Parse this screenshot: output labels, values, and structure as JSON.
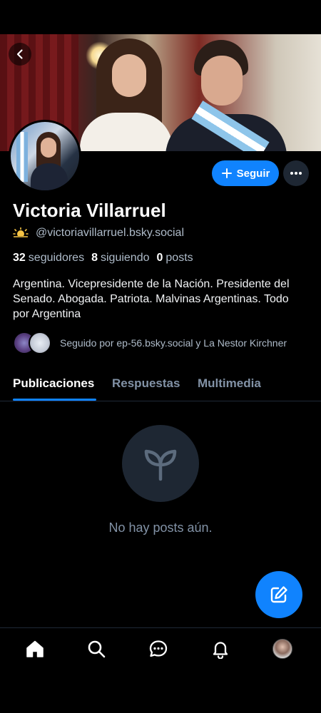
{
  "profile": {
    "display_name": "Victoria Villarruel",
    "handle": "@victoriavillarruel.bsky.social",
    "followers_count": "32",
    "followers_label": "seguidores",
    "following_count": "8",
    "following_label": "siguiendo",
    "posts_count": "0",
    "posts_label": "posts",
    "bio": "Argentina. Vicepresidente de la Nación. Presidente del Senado. Abogada. Patriota. Malvinas Argentinas. Todo por Argentina",
    "followed_by": "Seguido por ep-56.bsky.social y La Nestor Kirchner",
    "handle_emoji": "sun-behind-cloud-icon"
  },
  "actions": {
    "follow_label": "Seguir"
  },
  "tabs": [
    {
      "label": "Publicaciones",
      "active": true
    },
    {
      "label": "Respuestas",
      "active": false
    },
    {
      "label": "Multimedia",
      "active": false
    }
  ],
  "feed": {
    "empty_message": "No hay posts aún."
  },
  "colors": {
    "accent": "#1083fe",
    "background": "#000000",
    "muted_text": "#8292a6",
    "surface": "#1e2733"
  },
  "nav": [
    "home-icon",
    "search-icon",
    "chat-icon",
    "bell-icon",
    "profile-avatar"
  ]
}
